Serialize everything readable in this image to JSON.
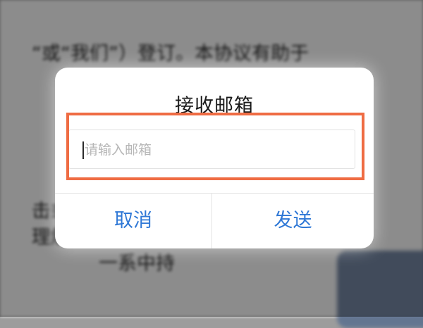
{
  "background": {
    "lines": [
      "“或“我们”）登订。本协议有助于",
      "击或",
      "理解",
      "一系中持"
    ]
  },
  "dialog": {
    "title": "接收邮箱",
    "email_input": {
      "value": "",
      "placeholder": "请输入邮箱"
    },
    "cancel_label": "取消",
    "send_label": "发送"
  },
  "colors": {
    "accent": "#2f78d6",
    "highlight": "#ef6c43"
  }
}
